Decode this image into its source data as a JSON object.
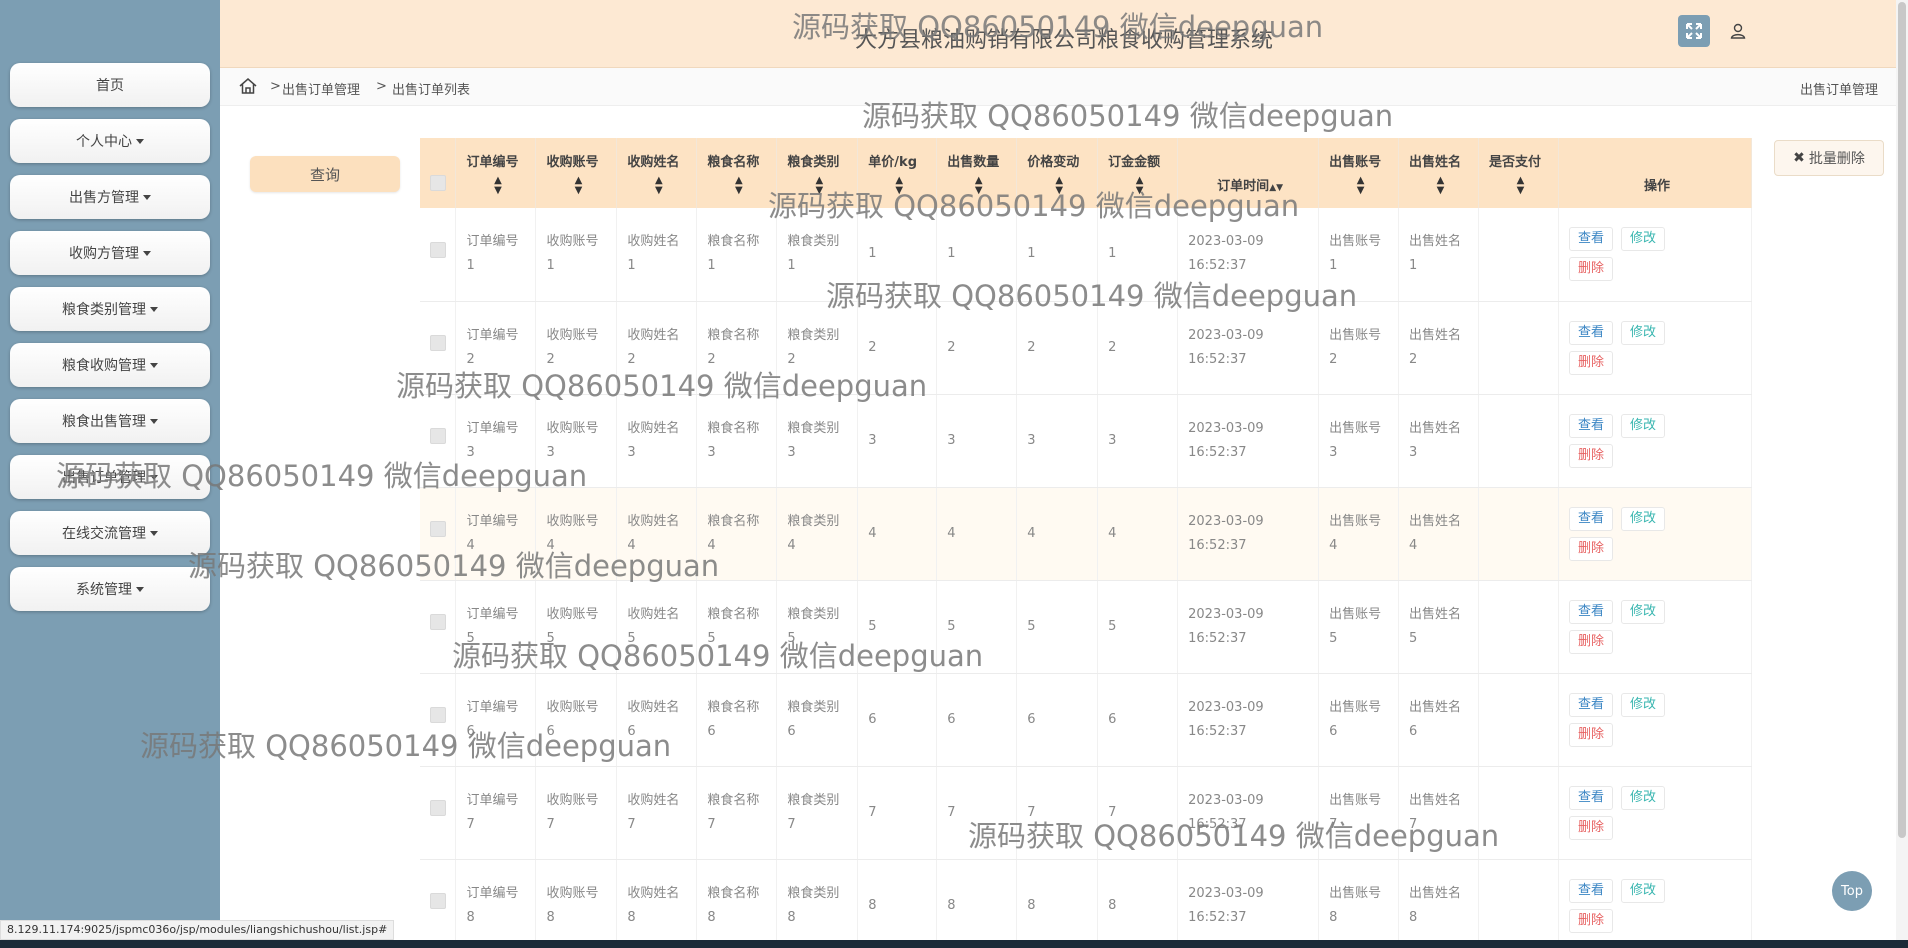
{
  "app_title": "大方县粮油购销有限公司粮食收购管理系统",
  "sidebar": {
    "items": [
      {
        "label": "首页",
        "dropdown": false
      },
      {
        "label": "个人中心",
        "dropdown": true
      },
      {
        "label": "出售方管理",
        "dropdown": true
      },
      {
        "label": "收购方管理",
        "dropdown": true
      },
      {
        "label": "粮食类别管理",
        "dropdown": true
      },
      {
        "label": "粮食收购管理",
        "dropdown": true
      },
      {
        "label": "粮食出售管理",
        "dropdown": true
      },
      {
        "label": "出售订单管理",
        "dropdown": true
      },
      {
        "label": "在线交流管理",
        "dropdown": true
      },
      {
        "label": "系统管理",
        "dropdown": true
      }
    ]
  },
  "breadcrumb": {
    "sep": ">",
    "items": [
      "出售订单管理",
      "出售订单列表"
    ],
    "right_title": "出售订单管理"
  },
  "toolbar": {
    "query_label": "查询",
    "batch_delete_label": "批量删除"
  },
  "table": {
    "headers": [
      "订单编号",
      "收购账号",
      "收购姓名",
      "粮食名称",
      "粮食类别",
      "单价/kg",
      "出售数量",
      "价格变动",
      "订金金额",
      "订单时间",
      "出售账号",
      "出售姓名",
      "是否支付",
      "操作"
    ],
    "actions": {
      "view": "查看",
      "edit": "修改",
      "delete": "删除"
    },
    "rows": [
      {
        "order_no": "订单编号",
        "n": "1",
        "buy_account": "收购账号",
        "buy_name": "收购姓名",
        "grain_name": "粮食名称",
        "grain_type": "粮食类别",
        "price": "1",
        "qty": "1",
        "change": "1",
        "deposit": "1",
        "date": "2023-03-09",
        "time": "16:52:37",
        "sell_account": "出售账号",
        "sell_name": "出售姓名",
        "paid": ""
      },
      {
        "order_no": "订单编号",
        "n": "2",
        "buy_account": "收购账号",
        "buy_name": "收购姓名",
        "grain_name": "粮食名称",
        "grain_type": "粮食类别",
        "price": "2",
        "qty": "2",
        "change": "2",
        "deposit": "2",
        "date": "2023-03-09",
        "time": "16:52:37",
        "sell_account": "出售账号",
        "sell_name": "出售姓名",
        "paid": ""
      },
      {
        "order_no": "订单编号",
        "n": "3",
        "buy_account": "收购账号",
        "buy_name": "收购姓名",
        "grain_name": "粮食名称",
        "grain_type": "粮食类别",
        "price": "3",
        "qty": "3",
        "change": "3",
        "deposit": "3",
        "date": "2023-03-09",
        "time": "16:52:37",
        "sell_account": "出售账号",
        "sell_name": "出售姓名",
        "paid": ""
      },
      {
        "order_no": "订单编号",
        "n": "4",
        "buy_account": "收购账号",
        "buy_name": "收购姓名",
        "grain_name": "粮食名称",
        "grain_type": "粮食类别",
        "price": "4",
        "qty": "4",
        "change": "4",
        "deposit": "4",
        "date": "2023-03-09",
        "time": "16:52:37",
        "sell_account": "出售账号",
        "sell_name": "出售姓名",
        "paid": ""
      },
      {
        "order_no": "订单编号",
        "n": "5",
        "buy_account": "收购账号",
        "buy_name": "收购姓名",
        "grain_name": "粮食名称",
        "grain_type": "粮食类别",
        "price": "5",
        "qty": "5",
        "change": "5",
        "deposit": "5",
        "date": "2023-03-09",
        "time": "16:52:37",
        "sell_account": "出售账号",
        "sell_name": "出售姓名",
        "paid": ""
      },
      {
        "order_no": "订单编号",
        "n": "6",
        "buy_account": "收购账号",
        "buy_name": "收购姓名",
        "grain_name": "粮食名称",
        "grain_type": "粮食类别",
        "price": "6",
        "qty": "6",
        "change": "6",
        "deposit": "6",
        "date": "2023-03-09",
        "time": "16:52:37",
        "sell_account": "出售账号",
        "sell_name": "出售姓名",
        "paid": ""
      },
      {
        "order_no": "订单编号",
        "n": "7",
        "buy_account": "收购账号",
        "buy_name": "收购姓名",
        "grain_name": "粮食名称",
        "grain_type": "粮食类别",
        "price": "7",
        "qty": "7",
        "change": "7",
        "deposit": "7",
        "date": "2023-03-09",
        "time": "16:52:37",
        "sell_account": "出售账号",
        "sell_name": "出售姓名",
        "paid": ""
      },
      {
        "order_no": "订单编号",
        "n": "8",
        "buy_account": "收购账号",
        "buy_name": "收购姓名",
        "grain_name": "粮食名称",
        "grain_type": "粮食类别",
        "price": "8",
        "qty": "8",
        "change": "8",
        "deposit": "8",
        "date": "2023-03-09",
        "time": "16:52:37",
        "sell_account": "出售账号",
        "sell_name": "出售姓名",
        "paid": ""
      }
    ]
  },
  "top_button_label": "Top",
  "status_url": "8.129.11.174:9025/jspmc036o/jsp/modules/liangshichushou/list.jsp#",
  "watermark_text": "源码获取 QQ86050149 微信deepguan",
  "colors": {
    "sidebar": "#7c9eb3",
    "header": "#fde9d3",
    "table_header": "#fde3c4",
    "view": "#3b86c4",
    "edit": "#39b6b0",
    "delete": "#e76262"
  },
  "icons": {
    "home": "home-icon",
    "fullscreen": "expand-icon",
    "user": "user-icon",
    "batch_delete": "close-icon",
    "sort": "sort-icon"
  }
}
